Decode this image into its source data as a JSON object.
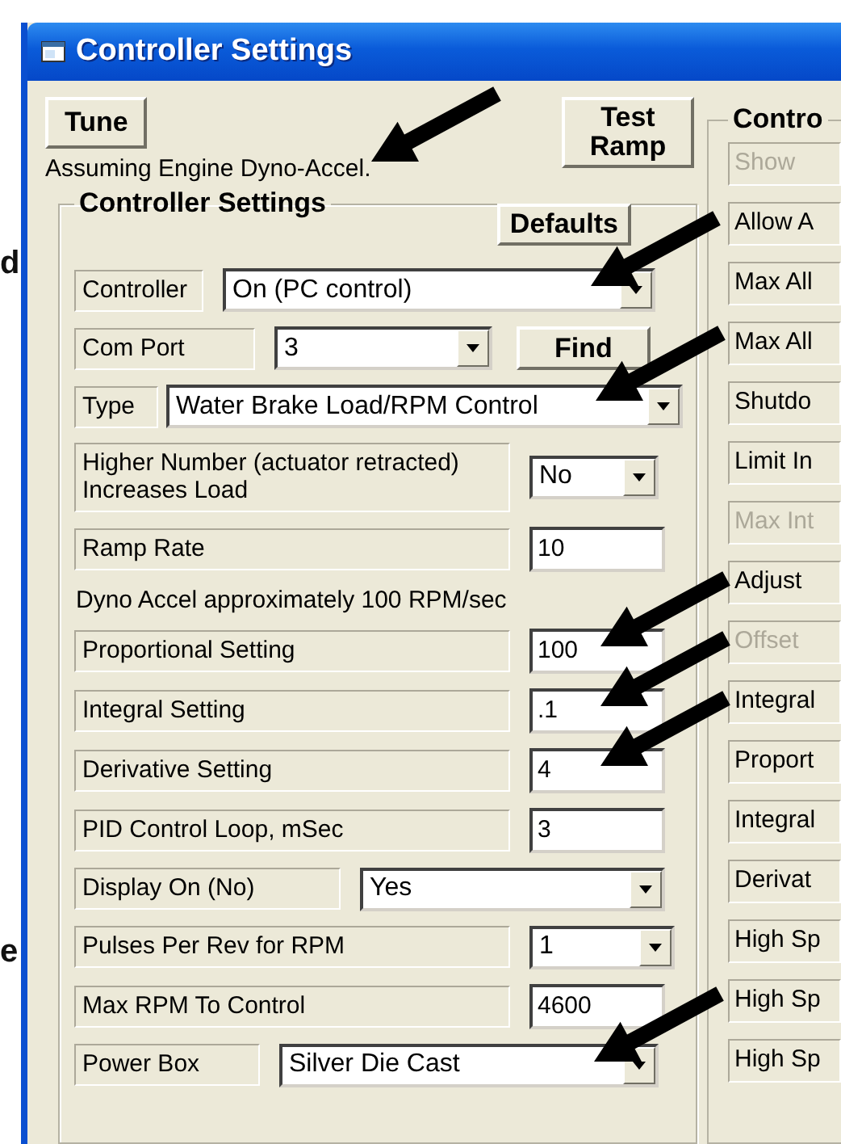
{
  "window": {
    "title": "Controller Settings"
  },
  "margin_letters": [
    "d",
    "e"
  ],
  "top_buttons": [
    {
      "label": "Tune"
    },
    {
      "label": "Test\nRamp"
    }
  ],
  "status_text": {
    "text": "Assuming Engine Dyno-Accel.",
    "arrow": true
  },
  "settings_group": {
    "title": "Controller Settings",
    "defaults_button": "Defaults",
    "rows": [
      {
        "kind": "dropdown",
        "label": "Controller",
        "value": "On (PC control)",
        "arrow": true
      },
      {
        "kind": "dropdown_button",
        "label": "Com Port",
        "value": "3",
        "button": "Find",
        "arrow": false
      },
      {
        "kind": "dropdown",
        "label": "Type",
        "value": "Water Brake Load/RPM Control",
        "arrow": true
      },
      {
        "kind": "dropdown",
        "label": "Higher Number (actuator retracted)\nIncreases Load",
        "value": "No",
        "arrow": false
      },
      {
        "kind": "input",
        "label": "Ramp Rate",
        "value": "10",
        "arrow": false
      },
      {
        "kind": "note",
        "text": "Dyno Accel approximately 100 RPM/sec"
      },
      {
        "kind": "input",
        "label": "Proportional Setting",
        "value": "100",
        "arrow": true
      },
      {
        "kind": "input",
        "label": "Integral Setting",
        "value": ".1",
        "arrow": true
      },
      {
        "kind": "input",
        "label": "Derivative Setting",
        "value": "4",
        "arrow": true
      },
      {
        "kind": "input",
        "label": "PID Control Loop, mSec",
        "value": "3",
        "arrow": false
      },
      {
        "kind": "dropdown",
        "label": "Display On (No)",
        "value": "Yes",
        "arrow": false
      },
      {
        "kind": "dropdown",
        "label": "Pulses Per Rev for RPM",
        "value": "1",
        "arrow": false
      },
      {
        "kind": "input",
        "label": "Max RPM To Control",
        "value": "4600",
        "arrow": false
      },
      {
        "kind": "dropdown",
        "label": "Power Box",
        "value": "Silver Die Cast",
        "arrow": true
      }
    ]
  },
  "right_group": {
    "title": "Contro",
    "items": [
      {
        "label": "Show",
        "disabled": true
      },
      {
        "label": "Allow A",
        "disabled": false
      },
      {
        "label": "Max All",
        "disabled": false
      },
      {
        "label": "Max All",
        "disabled": false
      },
      {
        "label": "Shutdo",
        "disabled": false
      },
      {
        "label": "Limit In",
        "disabled": false
      },
      {
        "label": "Max Int",
        "disabled": true
      },
      {
        "label": "Adjust",
        "disabled": false
      },
      {
        "label": "Offset",
        "disabled": true
      },
      {
        "label": "Integral",
        "disabled": false
      },
      {
        "label": "Proport",
        "disabled": false
      },
      {
        "label": "Integral",
        "disabled": false
      },
      {
        "label": "Derivat",
        "disabled": false
      },
      {
        "label": "High Sp",
        "disabled": false
      },
      {
        "label": "High Sp",
        "disabled": false
      },
      {
        "label": "High Sp",
        "disabled": false
      }
    ]
  }
}
